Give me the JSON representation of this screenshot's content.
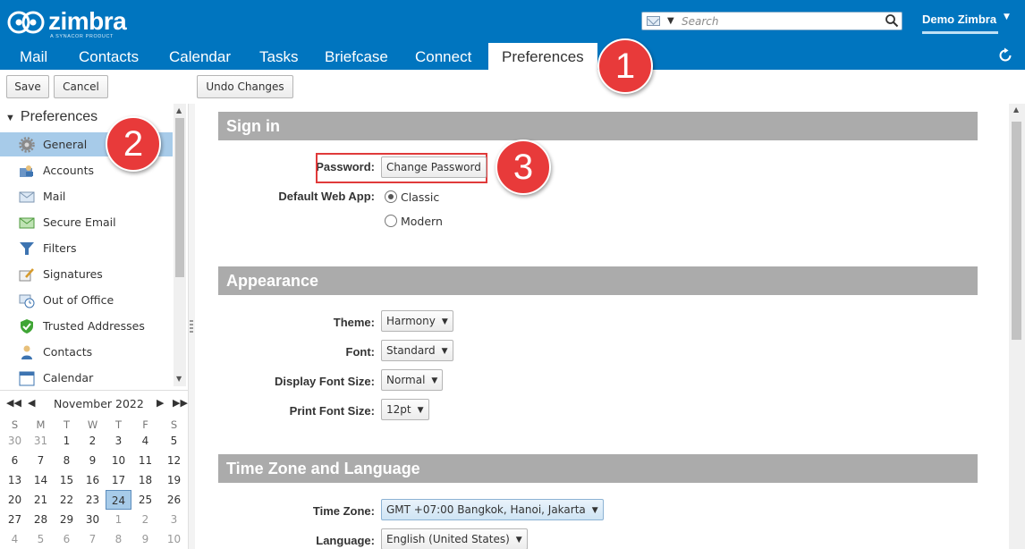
{
  "app": {
    "logo_text": "zimbra",
    "logo_tagline": "A SYNACOR PRODUCT",
    "user_name": "Demo Zimbra"
  },
  "search": {
    "placeholder": "Search"
  },
  "tabs": [
    {
      "label": "Mail"
    },
    {
      "label": "Contacts"
    },
    {
      "label": "Calendar"
    },
    {
      "label": "Tasks"
    },
    {
      "label": "Briefcase"
    },
    {
      "label": "Connect"
    },
    {
      "label": "Preferences",
      "active": true
    }
  ],
  "toolbar": {
    "save": "Save",
    "cancel": "Cancel",
    "undo": "Undo Changes"
  },
  "sidebar": {
    "header": "Preferences",
    "items": [
      {
        "label": "General",
        "icon": "gear-icon",
        "selected": true
      },
      {
        "label": "Accounts",
        "icon": "accounts-icon"
      },
      {
        "label": "Mail",
        "icon": "envelope-icon"
      },
      {
        "label": "Secure Email",
        "icon": "secure-email-icon"
      },
      {
        "label": "Filters",
        "icon": "filter-icon"
      },
      {
        "label": "Signatures",
        "icon": "signature-icon"
      },
      {
        "label": "Out of Office",
        "icon": "out-of-office-icon"
      },
      {
        "label": "Trusted Addresses",
        "icon": "shield-check-icon"
      },
      {
        "label": "Contacts",
        "icon": "person-icon"
      },
      {
        "label": "Calendar",
        "icon": "calendar-icon"
      }
    ]
  },
  "calendar": {
    "month_label": "November 2022",
    "weekdays": [
      "S",
      "M",
      "T",
      "W",
      "T",
      "F",
      "S"
    ],
    "weeks": [
      [
        [
          "30",
          true
        ],
        [
          "31",
          true
        ],
        [
          "1"
        ],
        [
          "2"
        ],
        [
          "3"
        ],
        [
          "4"
        ],
        [
          "5"
        ]
      ],
      [
        [
          "6"
        ],
        [
          "7"
        ],
        [
          "8"
        ],
        [
          "9"
        ],
        [
          "10"
        ],
        [
          "11"
        ],
        [
          "12"
        ]
      ],
      [
        [
          "13"
        ],
        [
          "14"
        ],
        [
          "15"
        ],
        [
          "16"
        ],
        [
          "17"
        ],
        [
          "18"
        ],
        [
          "19"
        ]
      ],
      [
        [
          "20"
        ],
        [
          "21"
        ],
        [
          "22"
        ],
        [
          "23"
        ],
        [
          "24"
        ],
        [
          "25"
        ],
        [
          "26"
        ]
      ],
      [
        [
          "27"
        ],
        [
          "28"
        ],
        [
          "29"
        ],
        [
          "30"
        ],
        [
          "1",
          true
        ],
        [
          "2",
          true
        ],
        [
          "3",
          true
        ]
      ],
      [
        [
          "4",
          true
        ],
        [
          "5",
          true
        ],
        [
          "6",
          true
        ],
        [
          "7",
          true
        ],
        [
          "8",
          true
        ],
        [
          "9",
          true
        ],
        [
          "10",
          true
        ]
      ]
    ],
    "today": "24"
  },
  "sections": {
    "sign_in": {
      "title": "Sign in",
      "password_label": "Password:",
      "password_button": "Change Password",
      "default_app_label": "Default Web App:",
      "options": [
        "Classic",
        "Modern"
      ],
      "selected": "Classic"
    },
    "appearance": {
      "title": "Appearance",
      "theme_label": "Theme:",
      "theme_value": "Harmony",
      "font_label": "Font:",
      "font_value": "Standard",
      "display_size_label": "Display Font Size:",
      "display_size_value": "Normal",
      "print_size_label": "Print Font Size:",
      "print_size_value": "12pt"
    },
    "timezone": {
      "title": "Time Zone and Language",
      "tz_label": "Time Zone:",
      "tz_value": "GMT +07:00 Bangkok, Hanoi, Jakarta",
      "lang_label": "Language:",
      "lang_value": "English (United States)"
    }
  },
  "callouts": [
    "1",
    "2",
    "3"
  ],
  "colors": {
    "brand": "#0075bf",
    "selected": "#a7cbe9",
    "section": "#ababab",
    "callout": "#e83a3a"
  }
}
